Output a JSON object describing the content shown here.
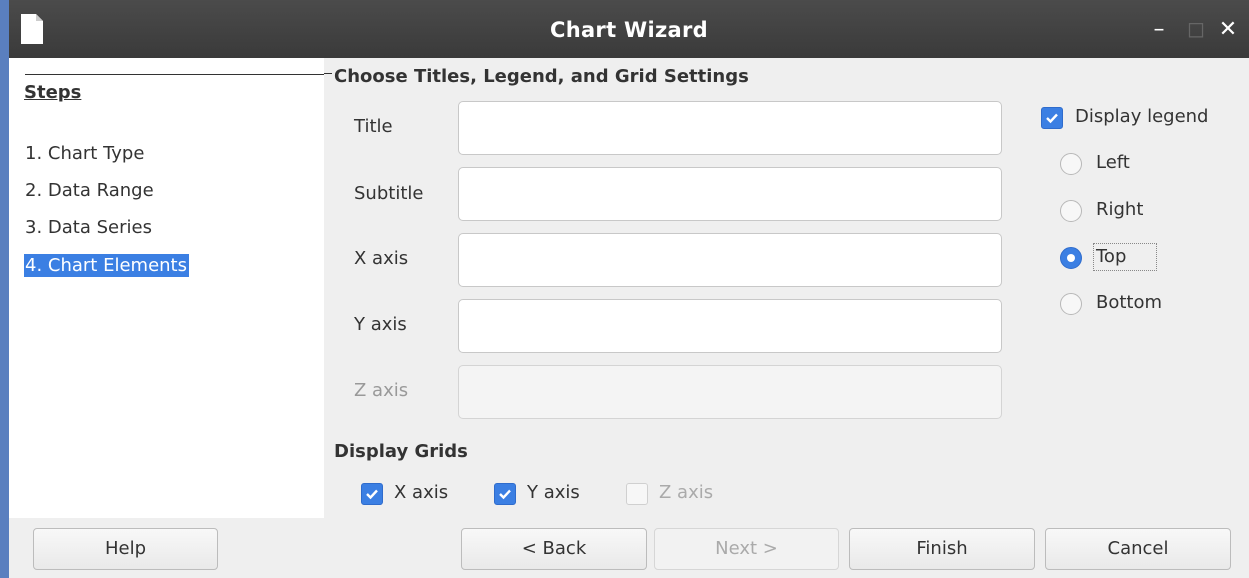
{
  "window": {
    "title": "Chart Wizard"
  },
  "steps": {
    "heading": "Steps",
    "items": [
      {
        "label": "1. Chart Type"
      },
      {
        "label": "2. Data Range"
      },
      {
        "label": "3. Data Series"
      },
      {
        "label": "4. Chart Elements"
      }
    ],
    "active_index": 3
  },
  "titles_section": {
    "heading": "Choose Titles, Legend, and Grid Settings",
    "fields": [
      {
        "label": "Title",
        "value": "",
        "enabled": true
      },
      {
        "label": "Subtitle",
        "value": "",
        "enabled": true
      },
      {
        "label": "X axis",
        "value": "",
        "enabled": true
      },
      {
        "label": "Y axis",
        "value": "",
        "enabled": true
      },
      {
        "label": "Z axis",
        "value": "",
        "enabled": false
      }
    ]
  },
  "legend": {
    "display_label": "Display legend",
    "display_checked": true,
    "positions": [
      {
        "label": "Left",
        "selected": false
      },
      {
        "label": "Right",
        "selected": false
      },
      {
        "label": "Top",
        "selected": true
      },
      {
        "label": "Bottom",
        "selected": false
      }
    ]
  },
  "grids": {
    "heading": "Display Grids",
    "items": [
      {
        "label": "X axis",
        "checked": true,
        "enabled": true
      },
      {
        "label": "Y axis",
        "checked": true,
        "enabled": true
      },
      {
        "label": "Z axis",
        "checked": false,
        "enabled": false
      }
    ]
  },
  "buttons": {
    "help": "Help",
    "back": "< Back",
    "next": "Next >",
    "finish": "Finish",
    "cancel": "Cancel"
  },
  "colors": {
    "accent": "#3b7fe3",
    "titlebar": "#3f3f3f",
    "desktop": "#5a7fbf"
  }
}
